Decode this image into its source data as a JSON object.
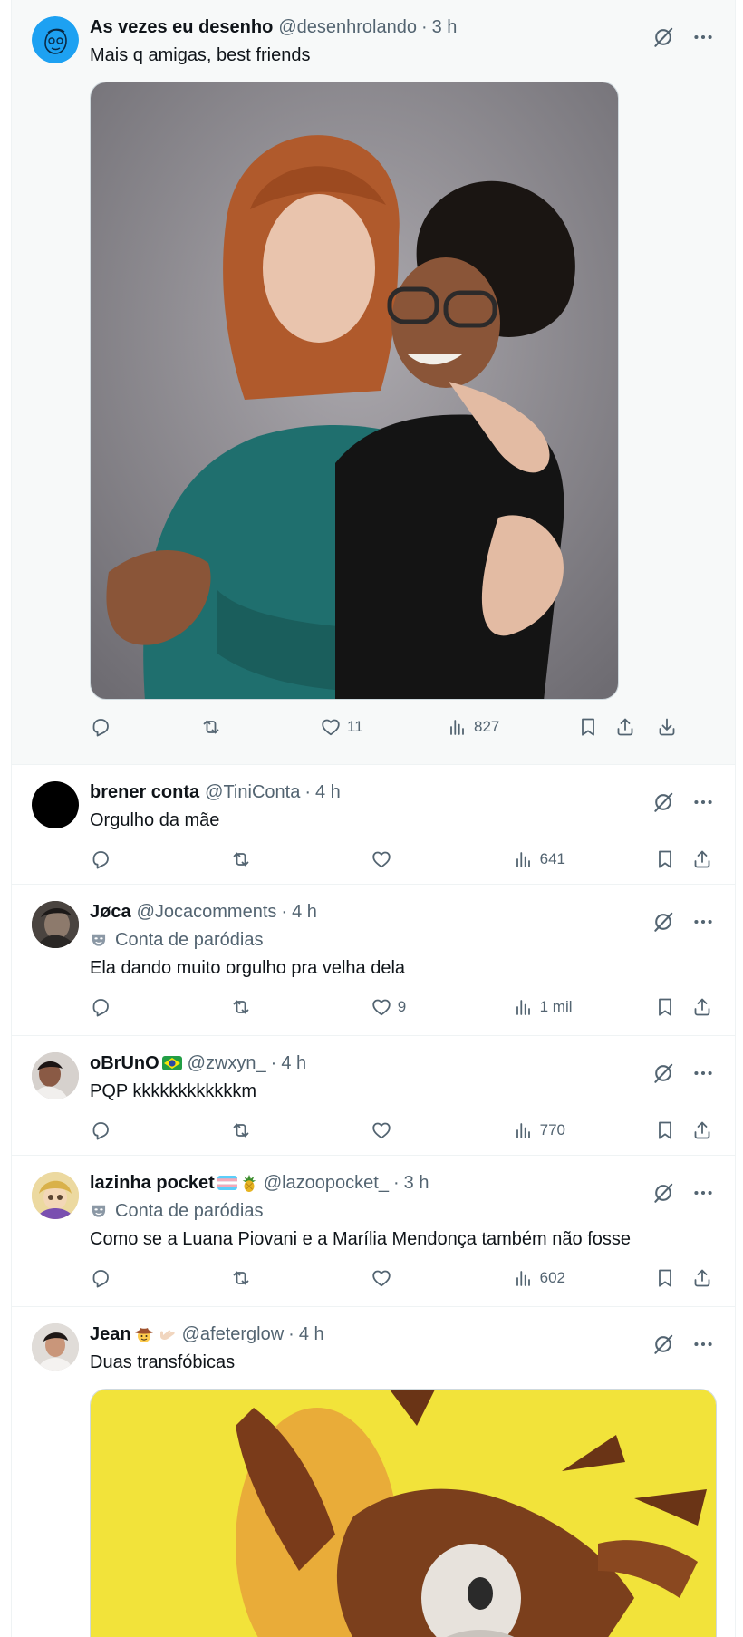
{
  "tweets": [
    {
      "display_name": "As vezes eu desenho",
      "handle": "@desenhrolando",
      "time": "3 h",
      "text": "Mais q amigas, best friends",
      "likes": "11",
      "views": "827"
    },
    {
      "display_name": "brener conta",
      "handle": "@TiniConta",
      "time": "4 h",
      "text": "Orgulho da mãe",
      "likes": "",
      "views": "641"
    },
    {
      "display_name": "Jøca",
      "handle": "@Jocacomments",
      "time": "4 h",
      "parody_label": "Conta de paródias",
      "text": "Ela dando muito orgulho pra velha dela",
      "likes": "9",
      "views": "1 mil"
    },
    {
      "display_name": "oBrUnO",
      "handle": "@zwxyn_",
      "time": "4 h",
      "text": "PQP kkkkkkkkkkkkm",
      "likes": "",
      "views": "770"
    },
    {
      "display_name": "lazinha pocket",
      "handle": "@lazoopocket_",
      "time": "3 h",
      "parody_label": "Conta de paródias",
      "text": "Como se a Luana Piovani e a Marília Mendonça também não fosse",
      "likes": "",
      "views": "602"
    },
    {
      "display_name": "Jean",
      "handle": "@afeterglow",
      "time": "4 h",
      "text": "Duas transfóbicas"
    }
  ],
  "icons": {
    "grok": "grok-icon",
    "more": "more-icon",
    "reply": "reply-icon",
    "repost": "repost-icon",
    "like": "heart-icon",
    "views": "views-icon",
    "bookmark": "bookmark-icon",
    "share": "share-icon",
    "download": "download-icon"
  },
  "colors": {
    "text": "#0f1419",
    "secondary": "#536471",
    "border": "#eff3f4",
    "highlight_bg": "#f7f9f9"
  }
}
